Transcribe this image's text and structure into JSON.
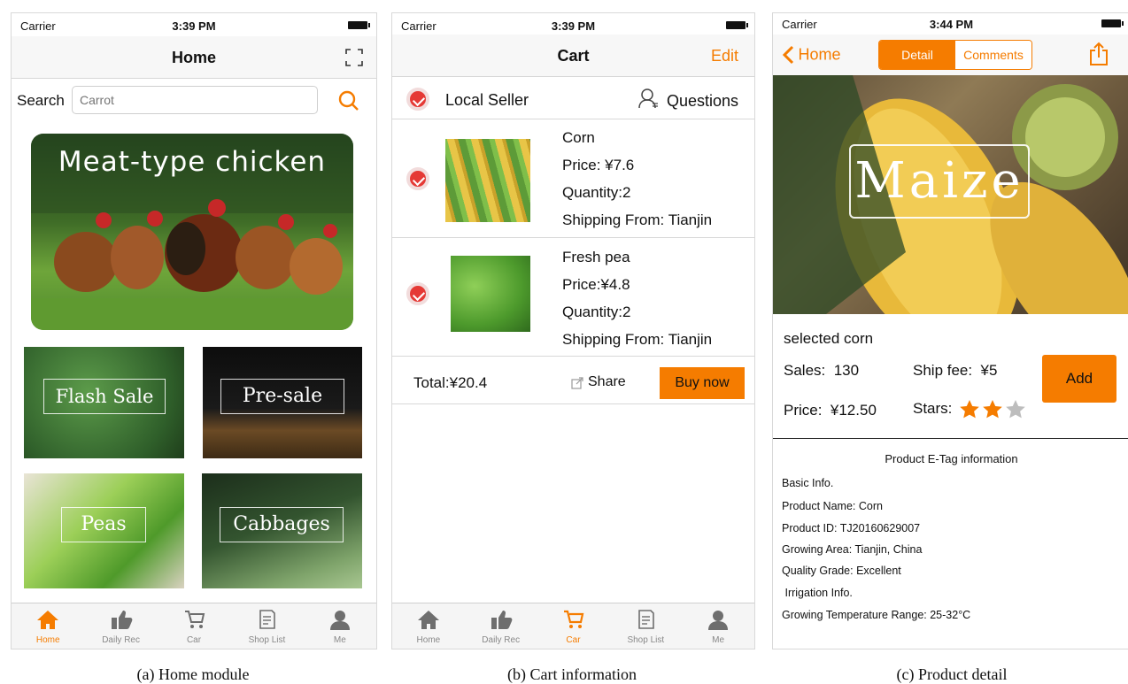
{
  "status_bar": {
    "carrier": "Carrier",
    "time_a": "3:39 PM",
    "time_b": "3:39 PM",
    "time_c": "3:44 PM"
  },
  "home": {
    "title": "Home",
    "search_label": "Search",
    "search_placeholder": "Carrot",
    "banner_text": "Meat-type chicken",
    "tiles": [
      "Flash Sale",
      "Pre-sale",
      "Peas",
      "Cabbages"
    ],
    "caption": "(a) Home module"
  },
  "cart": {
    "title": "Cart",
    "edit": "Edit",
    "seller": "Local Seller",
    "questions": "Questions",
    "items": [
      {
        "name": "Corn",
        "price": "Price: ¥7.6",
        "quantity": "Quantity:2",
        "shipping": "Shipping From: Tianjin"
      },
      {
        "name": "Fresh pea",
        "price": "Price:¥4.8",
        "quantity": "Quantity:2",
        "shipping": "Shipping From: Tianjin"
      }
    ],
    "total": "Total:¥20.4",
    "share": "Share",
    "buy_now": "Buy now",
    "caption": "(b) Cart information"
  },
  "detail": {
    "back": "Home",
    "seg_detail": "Detail",
    "seg_comments": "Comments",
    "hero_text": "Maize",
    "product_title": "selected corn",
    "sales": "Sales:  130",
    "ship_fee": "Ship fee:  ¥5",
    "price": "Price:  ¥12.50",
    "stars_label": "Stars:",
    "stars_rating": 2,
    "stars_max": 3,
    "add": "Add",
    "etag_title": "Product E-Tag information",
    "info_lines": [
      "Basic Info.",
      "Product Name: Corn",
      "Product ID: TJ20160629007",
      "Growing Area: Tianjin, China",
      "Quality Grade: Excellent",
      " Irrigation Info.",
      "Growing Temperature Range: 25-32°C"
    ],
    "caption": "(c) Product detail"
  },
  "tabbar": {
    "tabs": [
      "Home",
      "Daily Rec",
      "Car",
      "Shop List",
      "Me"
    ],
    "active_a": "Home",
    "active_b": "Car"
  },
  "colors": {
    "accent": "#f57c00",
    "check": "#e53935"
  }
}
